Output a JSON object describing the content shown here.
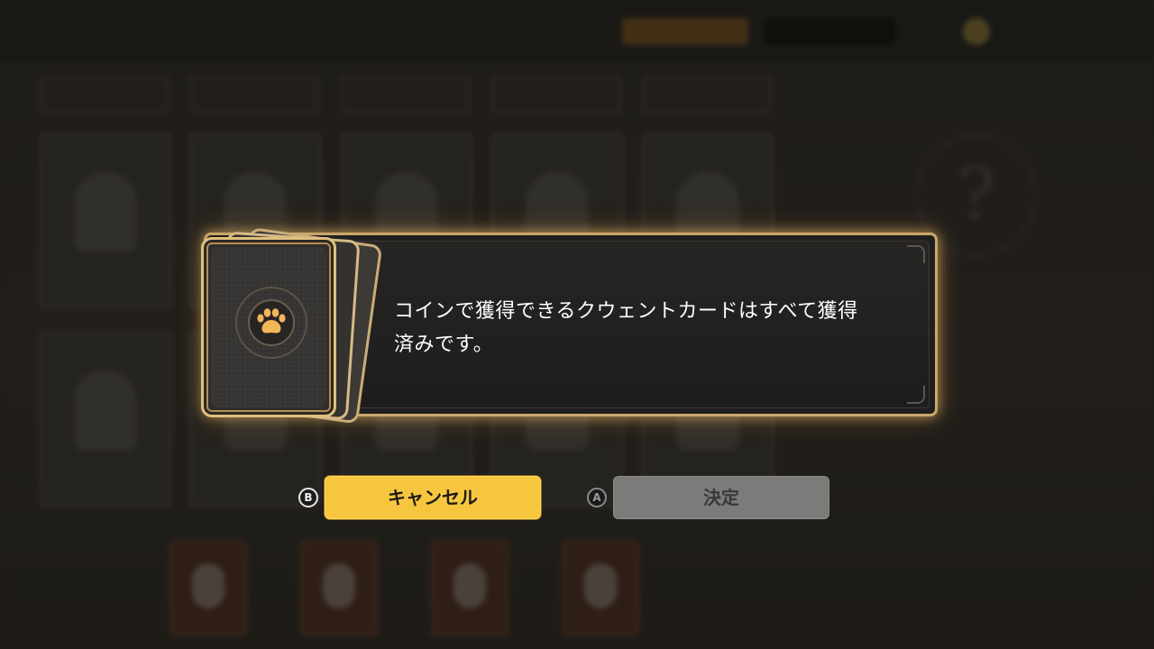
{
  "dialog": {
    "message_line1": "コインで獲得できるクウェントカードはすべて獲得",
    "message_line2": "済みです。"
  },
  "buttons": {
    "cancel": {
      "hint": "B",
      "label": "キャンセル"
    },
    "confirm": {
      "hint": "A",
      "label": "決定"
    }
  },
  "background": {
    "question_mark": "?"
  },
  "colors": {
    "accent_gold": "#f6c63f",
    "dialog_border": "#c9a76a",
    "disabled_button": "#7c7b79"
  },
  "icons": {
    "card_emblem": "paw-icon",
    "button_hints": [
      "b-button-icon",
      "a-button-icon"
    ]
  }
}
